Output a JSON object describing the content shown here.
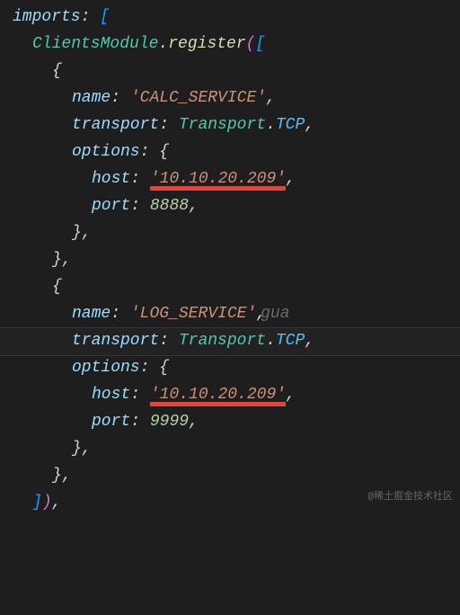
{
  "code": {
    "line1_imports": "imports",
    "line2_class": "ClientsModule",
    "line2_method": "register",
    "svc1": {
      "name_key": "name",
      "name_val": "'CALC_SERVICE'",
      "transport_key": "transport",
      "transport_class": "Transport",
      "transport_prop": "TCP",
      "options_key": "options",
      "host_key": "host",
      "host_val": "'10.10.20.209'",
      "port_key": "port",
      "port_val": "8888"
    },
    "svc2": {
      "name_key": "name",
      "name_val": "'LOG_SERVICE'",
      "transport_key": "transport",
      "transport_class": "Transport",
      "transport_prop": "TCP",
      "options_key": "options",
      "host_key": "host",
      "host_val": "'10.10.20.209'",
      "port_key": "port",
      "port_val": "9999"
    },
    "ghost_suggestion": "gua"
  },
  "watermark": "@稀土掘金技术社区"
}
